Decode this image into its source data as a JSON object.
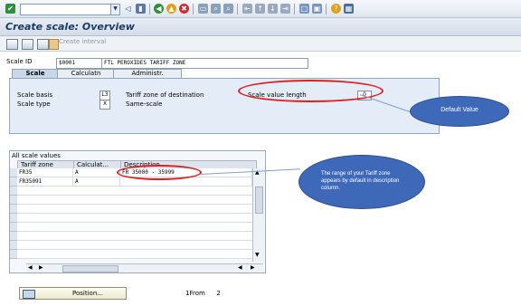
{
  "title": "Create scale: Overview",
  "app_toolbar": {
    "create_interval": "Create interval"
  },
  "header": {
    "scale_id_label": "Scale ID",
    "scale_id_value": "$0001",
    "scale_description": "FTL PEROXIDES TARIFF ZONE"
  },
  "tabs": [
    {
      "label": "Scale",
      "active": true
    },
    {
      "label": "Calculatn",
      "active": false
    },
    {
      "label": "Administr.",
      "active": false
    }
  ],
  "scale_tab": {
    "scale_basis_label": "Scale basis",
    "scale_basis_value": "L3",
    "scale_basis_desc": "Tariff zone of destination",
    "scale_type_label": "Scale type",
    "scale_type_value": "X",
    "scale_type_desc": "Same-scale",
    "value_length_label": "Scale value length",
    "value_length_value": "0"
  },
  "table": {
    "title": "All scale values",
    "columns": [
      "Tariff zone",
      "Calculat...",
      "Description"
    ],
    "rows": [
      {
        "zone": "FR35",
        "calc": "A",
        "desc": "FR 35000 - 35999"
      },
      {
        "zone": "FR35091",
        "calc": "A",
        "desc": ""
      }
    ]
  },
  "annotations": {
    "default_value": "Default Value",
    "range_note": "The range of your Tariff zone appears by default in description column."
  },
  "footer": {
    "position_button": "Position...",
    "entry_label": "1From",
    "entry_total": "2"
  },
  "colors": {
    "highlight": "#e02020",
    "callout": "#3e68b8",
    "panel": "#e4edf7",
    "title": "#1c3a63"
  },
  "icons": [
    "check-icon",
    "back-icon",
    "save-icon",
    "forward-icon",
    "exit-icon",
    "cancel-icon",
    "print-icon",
    "find-icon",
    "help-icon",
    "layout-icon"
  ]
}
